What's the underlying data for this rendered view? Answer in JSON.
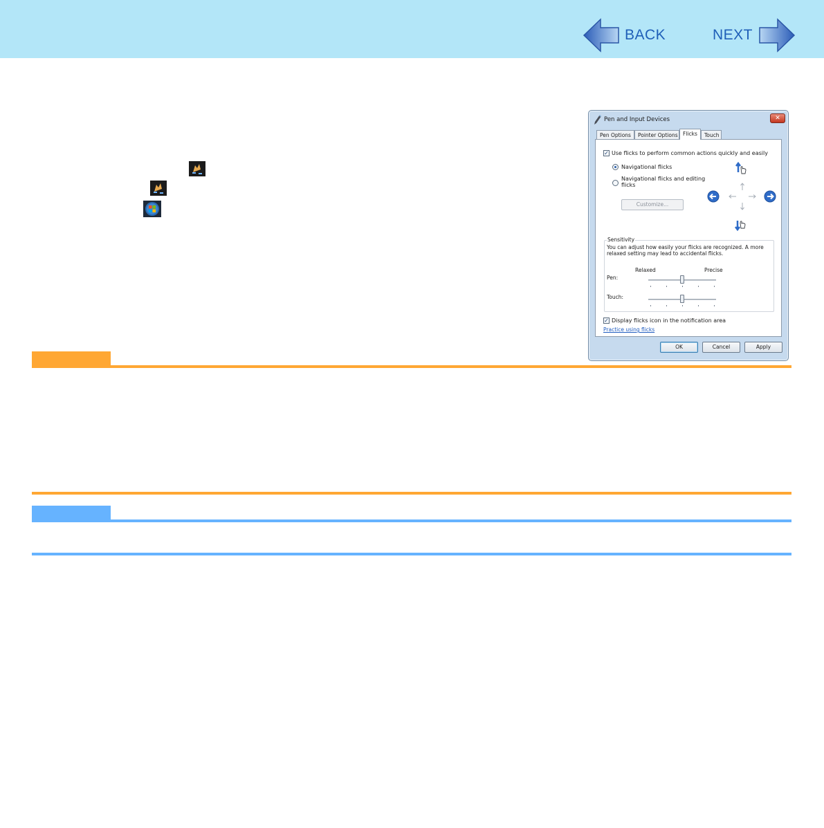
{
  "header": {
    "back_label": "BACK",
    "next_label": "NEXT"
  },
  "colors": {
    "header_bg": "#b3e6f8",
    "nav_text": "#1f5fb8",
    "caution_bar": "#ffa733",
    "note_bar": "#66b3ff"
  },
  "dialog": {
    "title": "Pen and Input Devices",
    "close_symbol": "✕",
    "tabs": [
      "Pen Options",
      "Pointer Options",
      "Flicks",
      "Touch"
    ],
    "active_tab": "Flicks",
    "use_flicks_label": "Use flicks to perform common actions quickly and easily",
    "use_flicks_checked": true,
    "radio_navigational": "Navigational flicks",
    "radio_editing_line1": "Navigational flicks and editing",
    "radio_editing_line2": "flicks",
    "selected_radio": "Navigational flicks",
    "customize_label": "Customize...",
    "sensitivity": {
      "legend": "Sensitivity",
      "description_line1": "You can adjust how easily your flicks are recognized. A more",
      "description_line2": "relaxed setting may lead to accidental flicks.",
      "relaxed_label": "Relaxed",
      "precise_label": "Precise",
      "pen_label": "Pen:",
      "touch_label": "Touch:",
      "pen_level": 0.5,
      "touch_level": 0.5
    },
    "display_icon_label": "Display flicks icon in the notification area",
    "display_icon_checked": true,
    "practice_link": "Practice using flicks",
    "ok_label": "OK",
    "cancel_label": "Cancel",
    "apply_label": "Apply"
  }
}
